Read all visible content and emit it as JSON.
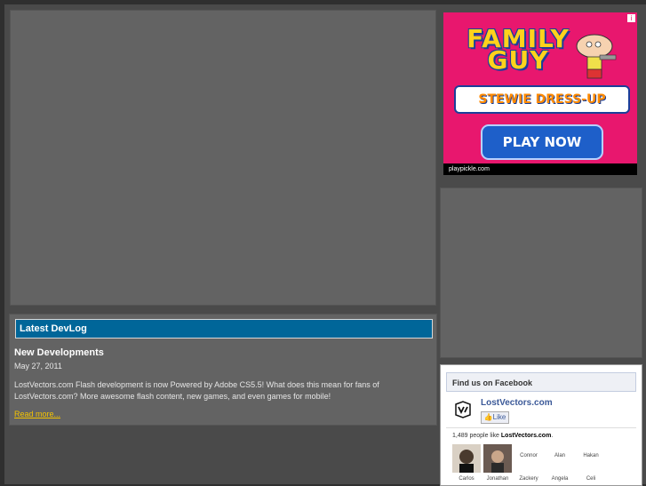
{
  "devlog": {
    "heading": "Latest DevLog",
    "post_title": "New Developments",
    "post_date": "May 27, 2011",
    "post_body": "LostVectors.com Flash development is now Powered by Adobe CS5.5! What does this mean for fans of LostVectors.com? More awesome flash content, new games, and even games for mobile!",
    "read_more": "Read more..."
  },
  "ad": {
    "close": "i",
    "title_line1": "FAMILY",
    "title_line2": "GUY",
    "subtitle": "STEWIE DRESS-UP",
    "button": "PLAY NOW",
    "source": "playpickle.com",
    "colors": {
      "background": "#e8176e",
      "title": "#ffd21c",
      "button": "#1e5fc9"
    }
  },
  "facebook": {
    "header": "Find us on Facebook",
    "page_name": "LostVectors.com",
    "like_label": "Like",
    "likes_prefix": "1,489 people like ",
    "likes_page": "LostVectors.com",
    "likes_suffix": ".",
    "fans_row1": [
      "Carlos",
      "Jonathan",
      "Connor",
      "Alan",
      "Hakan"
    ],
    "fans_row1_names_top": [
      "Connor",
      "Alan",
      "Hakan"
    ],
    "fans_row2": [
      "Carlos",
      "Jonathan",
      "Zackery",
      "Angela",
      "Celi"
    ]
  }
}
